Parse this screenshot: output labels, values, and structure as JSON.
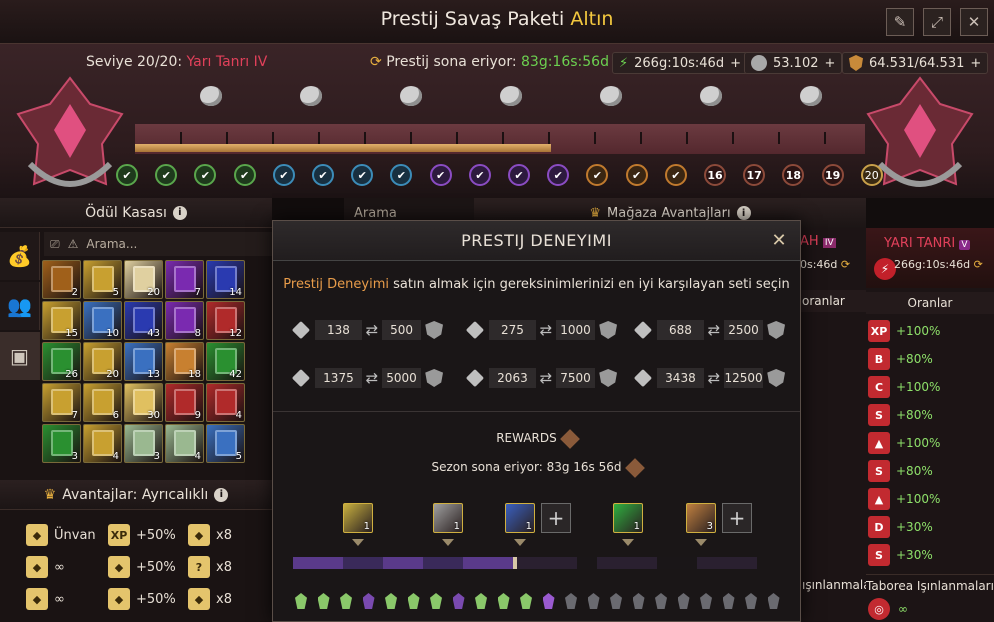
{
  "window": {
    "title_main": "Prestij Savaş Paketi",
    "title_accent": "Altın",
    "buttons": [
      "edit-icon",
      "fullscreen-icon",
      "close-icon"
    ]
  },
  "progress": {
    "level_label": "Seviye 20/20:",
    "level_tier": "Yarı Tanrı IV",
    "timer_label": "Prestij sona eriyor:",
    "timer_value": "83g:16s:56d",
    "currencies": [
      {
        "icon": "lightning-icon",
        "value": "266g:10s:46d",
        "plus": "+"
      },
      {
        "icon": "silver-coin-icon",
        "value": "53.102",
        "plus": "+"
      },
      {
        "icon": "shield-icon",
        "value": "64.531/64.531",
        "plus": "+"
      }
    ],
    "fill_fraction": 0.57,
    "nodes": [
      {
        "state": "g",
        "text": "✔"
      },
      {
        "state": "g",
        "text": "✔"
      },
      {
        "state": "g",
        "text": "✔"
      },
      {
        "state": "g",
        "text": "✔"
      },
      {
        "state": "b",
        "text": "✔"
      },
      {
        "state": "b",
        "text": "✔"
      },
      {
        "state": "b",
        "text": "✔"
      },
      {
        "state": "b",
        "text": "✔"
      },
      {
        "state": "p",
        "text": "✔"
      },
      {
        "state": "p",
        "text": "✔"
      },
      {
        "state": "p",
        "text": "✔"
      },
      {
        "state": "p",
        "text": "✔"
      },
      {
        "state": "o",
        "text": "✔"
      },
      {
        "state": "o",
        "text": "✔"
      },
      {
        "state": "o",
        "text": "✔"
      },
      {
        "state": "num",
        "text": "16"
      },
      {
        "state": "num",
        "text": "17"
      },
      {
        "state": "num",
        "text": "18"
      },
      {
        "state": "num",
        "text": "19"
      },
      {
        "state": "last",
        "text": "20"
      }
    ]
  },
  "left": {
    "vault_title": "Ödül Kasası",
    "search_placeholder": "Arama...",
    "categories": [
      "bag-icon",
      "hero-icon",
      "chest-icon"
    ],
    "items": [
      {
        "color": "#a0601a",
        "count": "2"
      },
      {
        "color": "#c8a030",
        "count": "5"
      },
      {
        "color": "#e0d0a0",
        "count": "20"
      },
      {
        "color": "#7a2ab0",
        "count": "7"
      },
      {
        "color": "#2a3ab0",
        "count": "14"
      },
      {
        "color": "#c8a030",
        "count": "15"
      },
      {
        "color": "#3a70c0",
        "count": "10"
      },
      {
        "color": "#2a3ab0",
        "count": "43"
      },
      {
        "color": "#7a2ab0",
        "count": "8"
      },
      {
        "color": "#b02a2a",
        "count": "12"
      },
      {
        "color": "#2a9030",
        "count": "26"
      },
      {
        "color": "#c8a030",
        "count": "20"
      },
      {
        "color": "#3a70c0",
        "count": "13"
      },
      {
        "color": "#c88030",
        "count": "18"
      },
      {
        "color": "#2a9030",
        "count": "42"
      },
      {
        "color": "#c8a030",
        "count": "7"
      },
      {
        "color": "#c8a030",
        "count": "6"
      },
      {
        "color": "#e0c060",
        "count": "30"
      },
      {
        "color": "#b02a2a",
        "count": "9"
      },
      {
        "color": "#b02a2a",
        "count": "4"
      },
      {
        "color": "#2a9030",
        "count": "3"
      },
      {
        "color": "#c8a030",
        "count": "4"
      },
      {
        "color": "#9ab890",
        "count": "3"
      },
      {
        "color": "#9ab890",
        "count": "4"
      },
      {
        "color": "#3a70c0",
        "count": "5"
      }
    ],
    "perks_title": "Avantajlar: Ayrıcalıklı",
    "perks": [
      {
        "icon": "title-icon",
        "label": "Ünvan"
      },
      {
        "icon": "xp-icon",
        "label": "+50%"
      },
      {
        "icon": "timer-icon",
        "label": "x8"
      },
      {
        "icon": "sun-icon",
        "label": "∞"
      },
      {
        "icon": "book-icon",
        "label": "+50%"
      },
      {
        "icon": "question-icon",
        "label": "x8"
      },
      {
        "icon": "download-icon",
        "label": "∞"
      },
      {
        "icon": "clover-icon",
        "label": "+50%"
      },
      {
        "icon": "cards-icon",
        "label": "x8"
      }
    ]
  },
  "middle": {
    "search_label": "Arama",
    "store_title": "Mağaza Avantajları"
  },
  "right": {
    "cut_title": "AH",
    "cut_timer": "0s:46d",
    "cut_rates": "oranlar",
    "cut_rays": "ışınlanmaları",
    "tier": "YARI TANRI",
    "tier_timer": "266g:10s:46d",
    "rates_title": "Oranlar",
    "rates": [
      {
        "icon": "XP",
        "value": "+100%"
      },
      {
        "icon": "B",
        "value": "+80%"
      },
      {
        "icon": "C",
        "value": "+100%"
      },
      {
        "icon": "S",
        "value": "+80%"
      },
      {
        "icon": "▲",
        "value": "+100%"
      },
      {
        "icon": "S",
        "value": "+80%"
      },
      {
        "icon": "▲",
        "value": "+100%"
      },
      {
        "icon": "D",
        "value": "+30%"
      },
      {
        "icon": "S",
        "value": "+30%"
      }
    ],
    "teleports_title": "Taborea Işınlanmaları",
    "teleports_value": "∞"
  },
  "modal": {
    "title": "PRESTIJ DENEYIMI",
    "desc_highlight": "Prestij Deneyimi",
    "desc_rest": " satın almak için gereksinimlerinizi en iyi karşılayan seti seçin",
    "sets": [
      {
        "cost": "138",
        "xp": "500"
      },
      {
        "cost": "275",
        "xp": "1000"
      },
      {
        "cost": "688",
        "xp": "2500"
      },
      {
        "cost": "1375",
        "xp": "5000"
      },
      {
        "cost": "2063",
        "xp": "7500"
      },
      {
        "cost": "3438",
        "xp": "12500"
      }
    ],
    "rewards_title": "REWARDS",
    "season_text": "Sezon sona eriyor: 83g 16s 56d",
    "reward_icons": [
      {
        "color": "#c8b040",
        "count": "1"
      },
      {
        "color": "#a0a0a0",
        "count": "1"
      },
      {
        "color": "#3a60c0",
        "count": "1"
      },
      {
        "color": "#30b040",
        "count": "1"
      },
      {
        "color": "#c08040",
        "count": "3"
      }
    ]
  }
}
